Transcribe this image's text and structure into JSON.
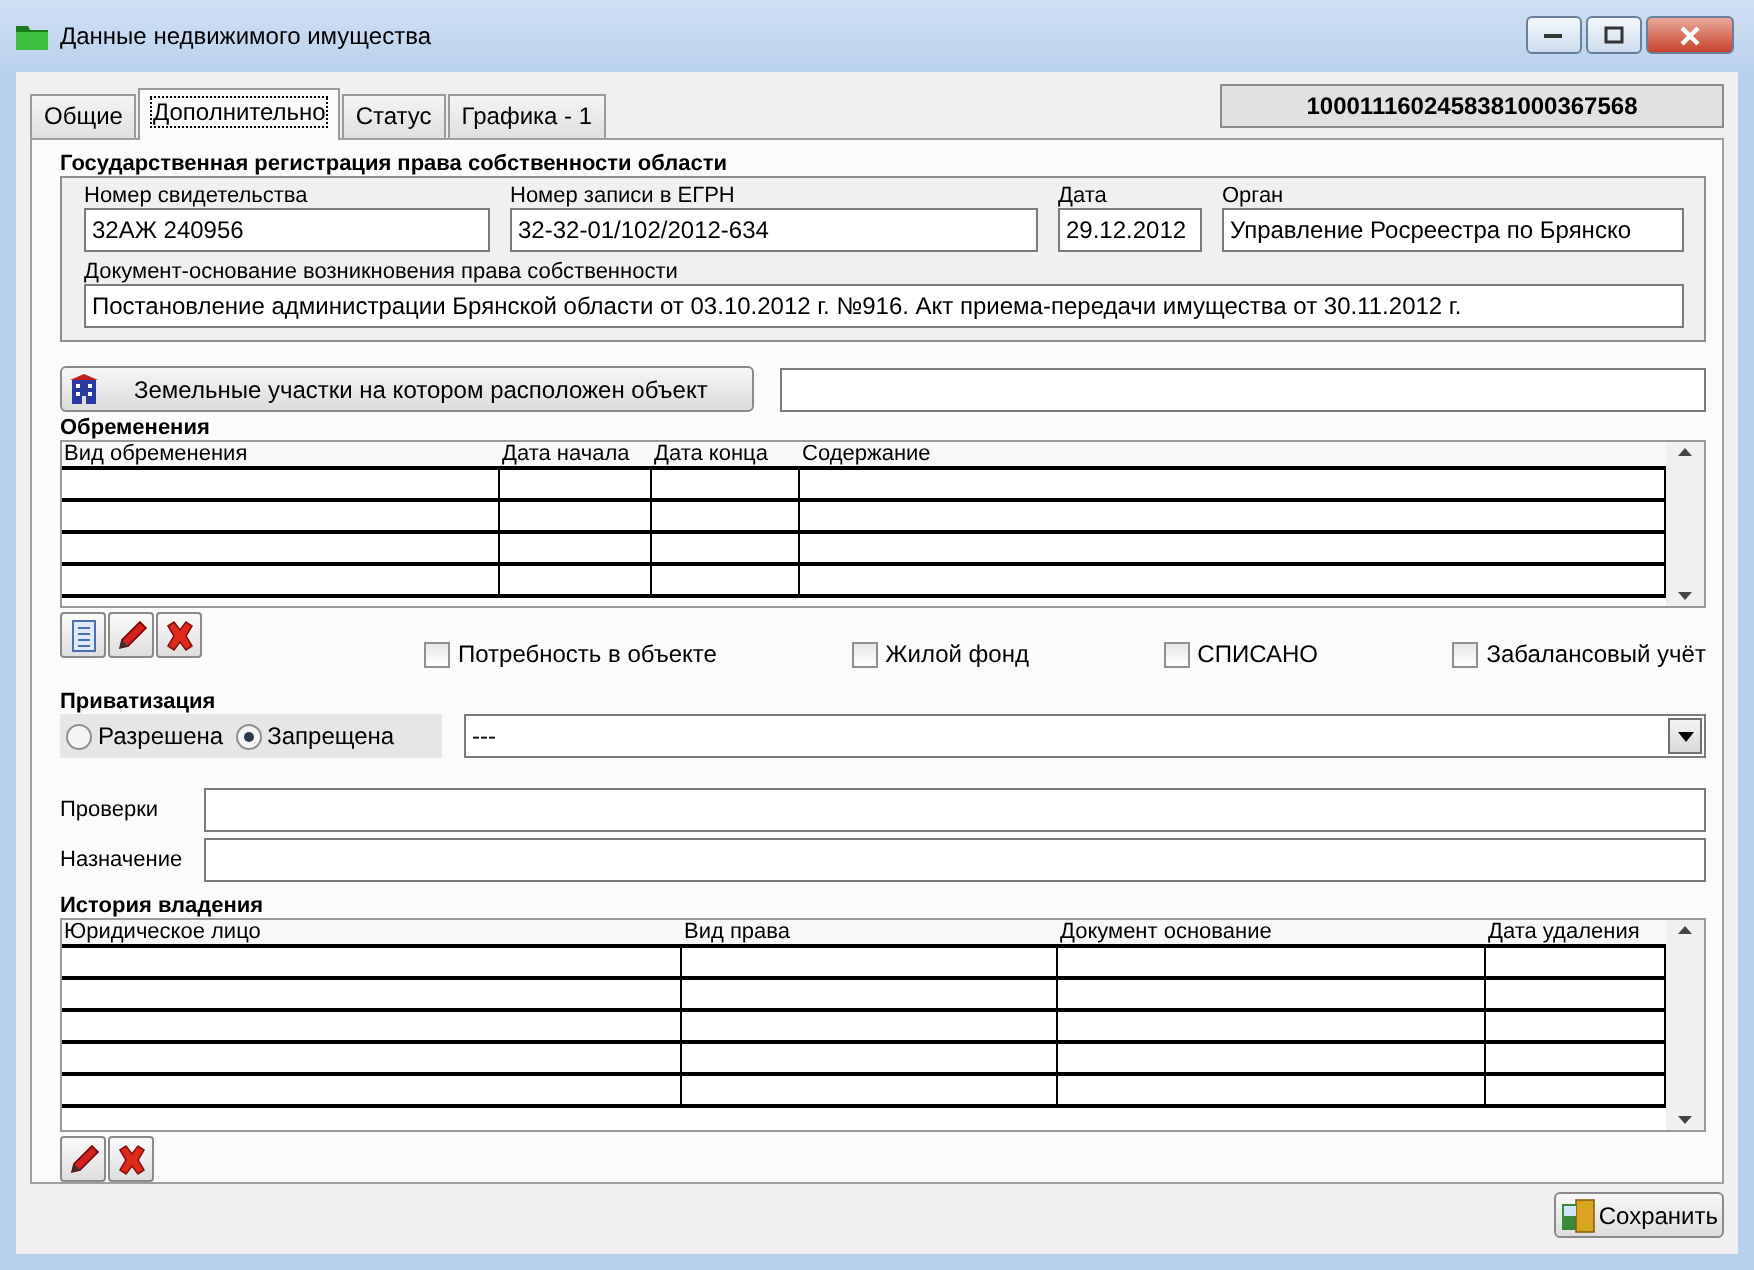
{
  "window": {
    "title": "Данные недвижимого имущества"
  },
  "tabs": [
    {
      "label": "Общие",
      "selected": false
    },
    {
      "label": "Дополнительно",
      "selected": true
    },
    {
      "label": "Статус",
      "selected": false
    },
    {
      "label": "Графика - 1",
      "selected": false
    }
  ],
  "record_id": "1000111602458381000367568",
  "state_registration": {
    "title": "Государственная регистрация права собственности области",
    "fields": [
      {
        "label": "Номер свидетельства",
        "value": "32АЖ 240956"
      },
      {
        "label": "Номер записи в ЕГРН",
        "value": "32-32-01/102/2012-634"
      },
      {
        "label": "Дата",
        "value": "29.12.2012"
      },
      {
        "label": "Орган",
        "value": "Управление Росреестра по Брянско"
      }
    ],
    "basis_document": {
      "label": "Документ-основание возникновения права собственности",
      "value": "Постановление администрации Брянской области от 03.10.2012 г. №916. Акт приема-передачи имущества от 30.11.2012 г."
    }
  },
  "land_plots_button": "Земельные участки на котором расположен объект",
  "encumbrances": {
    "title": "Обременения",
    "columns": [
      "Вид обременения",
      "Дата начала",
      "Дата конца",
      "Содержание"
    ]
  },
  "flags": [
    {
      "label": "Потребность в объекте",
      "checked": false
    },
    {
      "label": "Жилой фонд",
      "checked": false
    },
    {
      "label": "СПИСАНО",
      "checked": false
    },
    {
      "label": "Забалансовый учёт",
      "checked": false
    }
  ],
  "privatization": {
    "title": "Приватизация",
    "options": [
      {
        "label": "Разрешена",
        "selected": false
      },
      {
        "label": "Запрещена",
        "selected": true
      }
    ],
    "select_value": "---"
  },
  "text_fields": [
    {
      "label": "Проверки"
    },
    {
      "label": "Назначение"
    }
  ],
  "ownership_history": {
    "title": "История владения",
    "columns": [
      "Юридическое лицо",
      "Вид права",
      "Документ основание",
      "Дата удаления"
    ]
  },
  "save_button": "Сохранить"
}
